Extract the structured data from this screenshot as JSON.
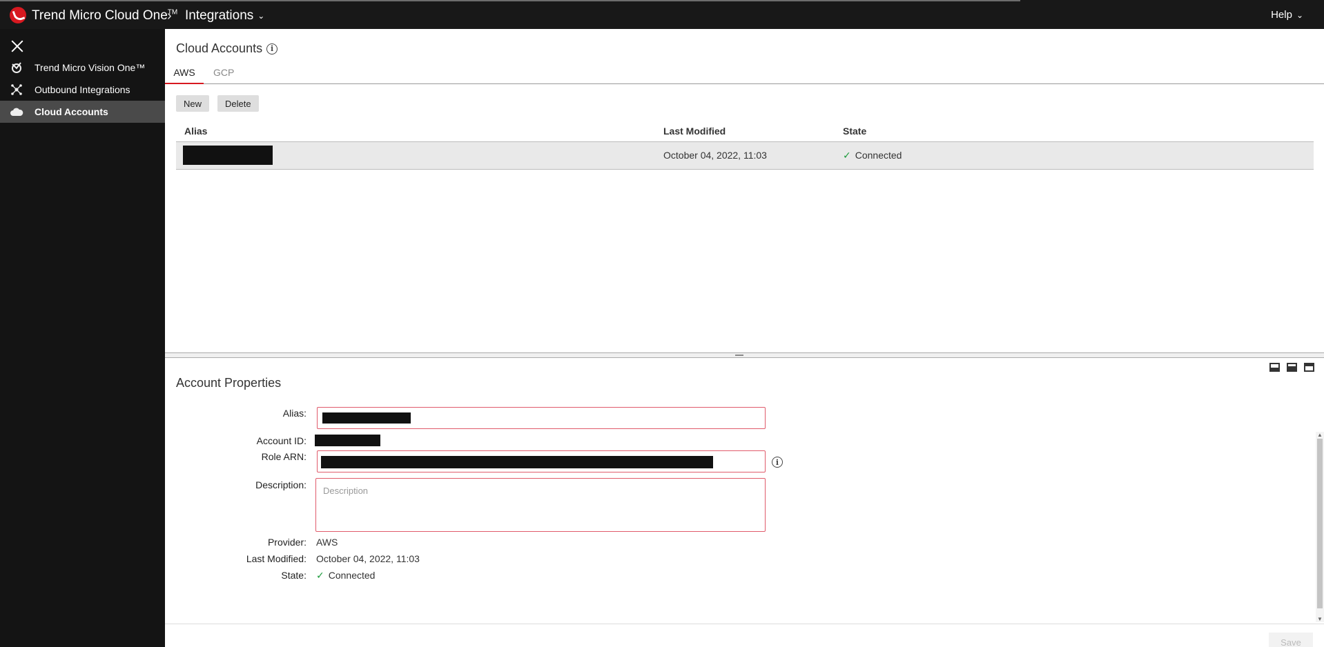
{
  "topbar": {
    "brand": "Trend Micro Cloud One",
    "brand_tm": "TM",
    "crumb_sep": "›",
    "section": "Integrations",
    "help": "Help"
  },
  "sidebar": {
    "items": [
      {
        "label": "Trend Micro Vision One™",
        "icon": "vision-one-icon"
      },
      {
        "label": "Outbound Integrations",
        "icon": "network-icon"
      },
      {
        "label": "Cloud Accounts",
        "icon": "cloud-icon",
        "active": true
      }
    ]
  },
  "main": {
    "title": "Cloud Accounts",
    "tabs": [
      {
        "label": "AWS",
        "active": true
      },
      {
        "label": "GCP",
        "active": false
      }
    ],
    "toolbar": {
      "new_label": "New",
      "delete_label": "Delete"
    },
    "table": {
      "columns": [
        "Alias",
        "Last Modified",
        "State"
      ],
      "rows": [
        {
          "alias": "[redacted]",
          "last_modified": "October 04, 2022, 11:03",
          "state": "Connected"
        }
      ]
    }
  },
  "properties": {
    "title": "Account Properties",
    "alias_label": "Alias:",
    "account_id_label": "Account ID:",
    "role_arn_label": "Role ARN:",
    "description_label": "Description:",
    "description_placeholder": "Description",
    "provider_label": "Provider:",
    "provider_value": "AWS",
    "last_modified_label": "Last Modified:",
    "last_modified_value": "October 04, 2022, 11:03",
    "state_label": "State:",
    "state_value": "Connected",
    "save_label": "Save"
  },
  "colors": {
    "accent": "#d71920",
    "connected": "#1a9a3a",
    "invalid_border": "#e05a6a"
  }
}
